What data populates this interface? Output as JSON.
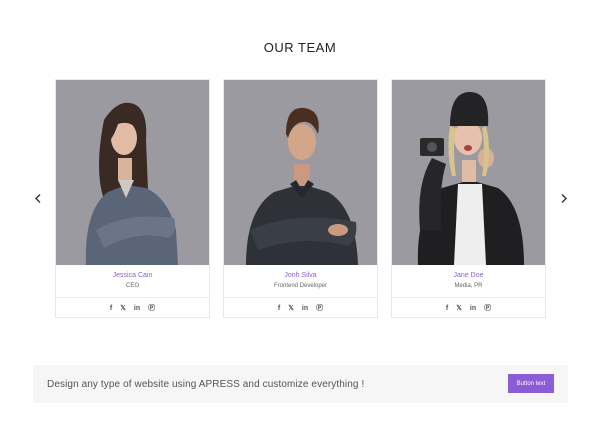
{
  "section": {
    "title": "OUR TEAM"
  },
  "carousel": {
    "prev_icon": "chevron-left-icon",
    "next_icon": "chevron-right-icon"
  },
  "members": [
    {
      "name": "Jessica Cain",
      "role": "CEO"
    },
    {
      "name": "Jonh Silva",
      "role": "Frontend Developer"
    },
    {
      "name": "Jane Doe",
      "role": "Media, PR"
    }
  ],
  "social_icons": [
    "facebook-icon",
    "twitter-icon",
    "linkedin-icon",
    "pinterest-icon"
  ],
  "cta": {
    "text": "Design any type of website using APRESS and customize everything !",
    "button_label": "Button text"
  },
  "colors": {
    "accent": "#8a5cd6",
    "name_text": "#8a63d2",
    "photo_bg": "#9a9aa0",
    "cta_bg": "#f6f6f6"
  }
}
